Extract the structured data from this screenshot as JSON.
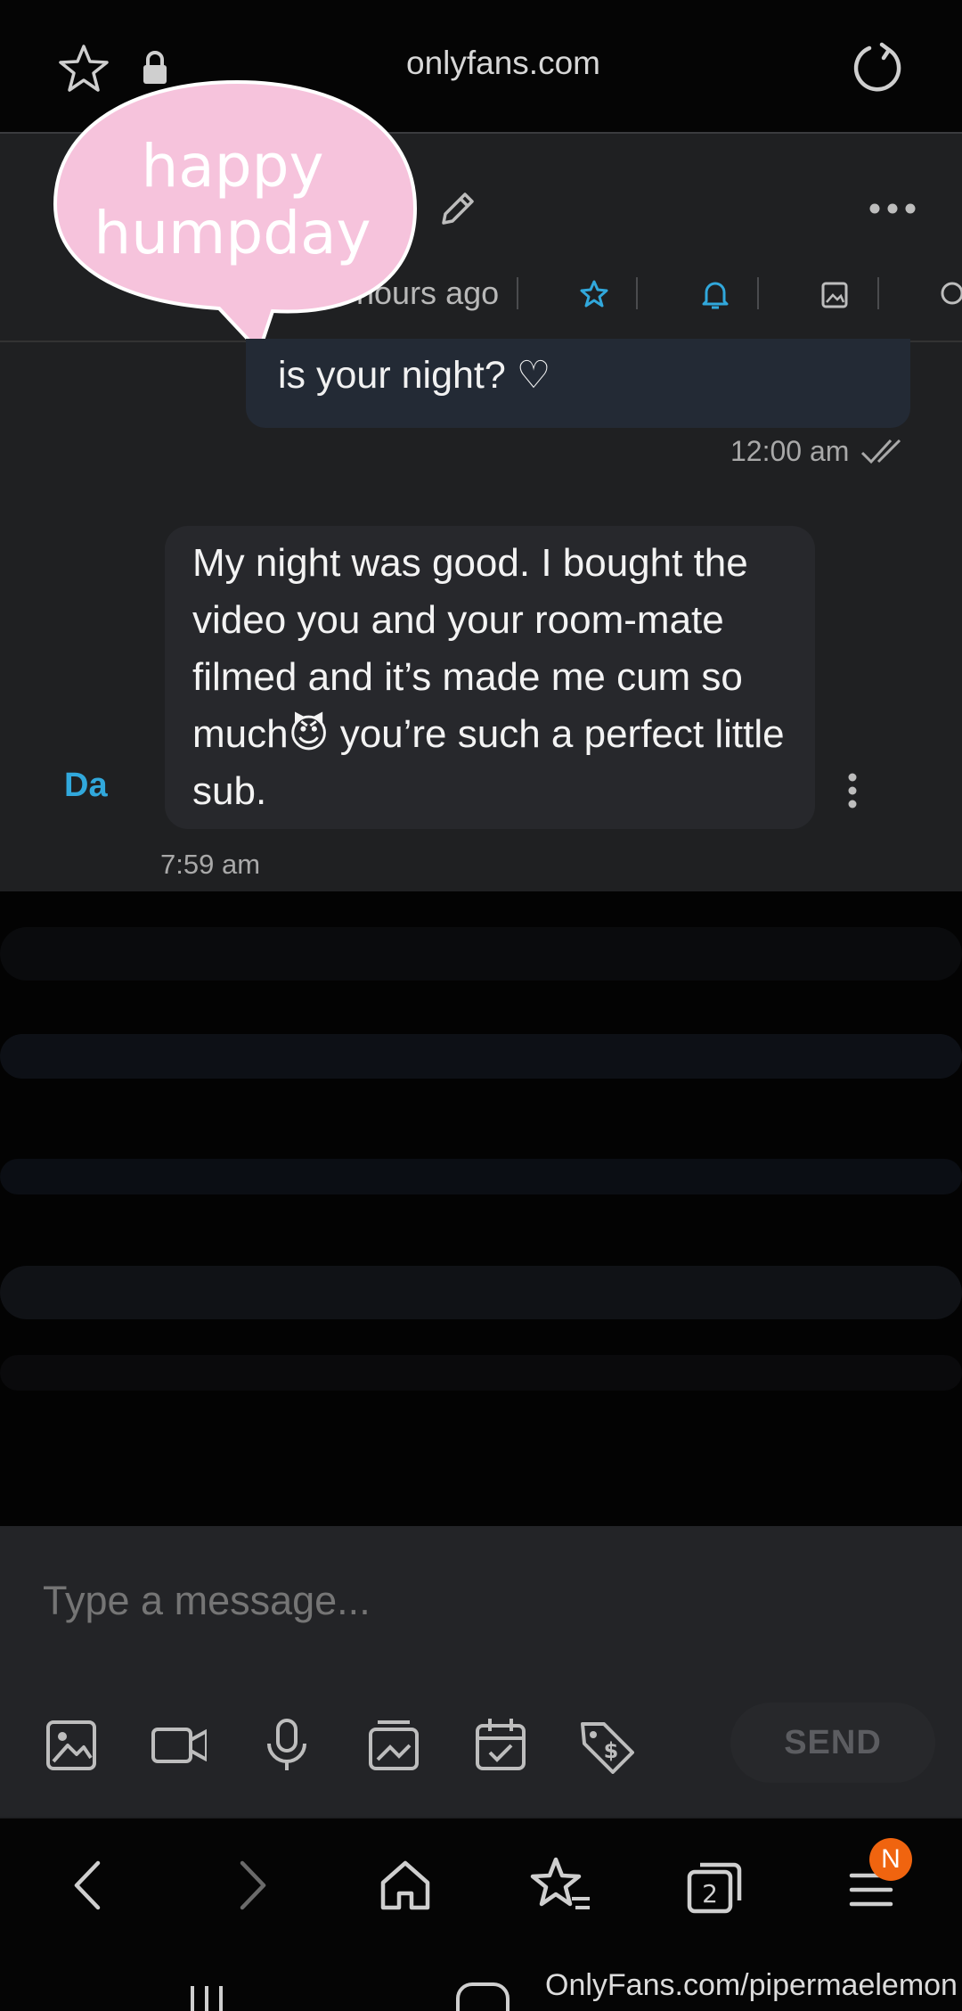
{
  "browser": {
    "url": "onlyfans.com",
    "tab_count": "2",
    "menu_badge": "N"
  },
  "sticker": {
    "line1": "happy",
    "line2": "humpday"
  },
  "header": {
    "time_ago": "... hours ago"
  },
  "messages": [
    {
      "direction": "out",
      "text": "is your night? ♡",
      "time": "12:00 am"
    },
    {
      "direction": "in",
      "sender_initials": "Da",
      "text": "My night was good. I bought the video you and your room-mate filmed and it’s made me cum so much😈 you’re such a perfect little sub.",
      "time": "7:59 am"
    }
  ],
  "composer": {
    "placeholder": "Type a message...",
    "send_label": "SEND"
  },
  "watermark": "OnlyFans.com/pipermaelemon",
  "colors": {
    "accent": "#31a8dc",
    "badge": "#f0640f",
    "sticker": "#f6c3dc"
  }
}
